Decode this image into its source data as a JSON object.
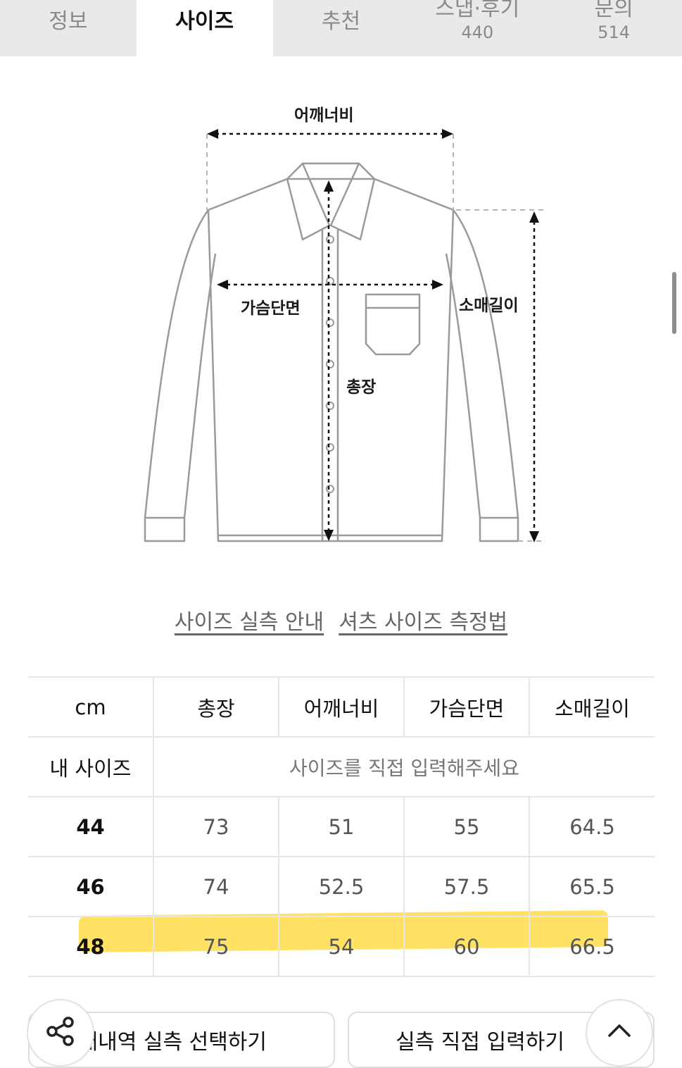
{
  "tabs": [
    {
      "label": "정보",
      "count": ""
    },
    {
      "label": "사이즈",
      "count": ""
    },
    {
      "label": "추천",
      "count": ""
    },
    {
      "label": "스냅·후기",
      "count": "440"
    },
    {
      "label": "문의",
      "count": "514"
    }
  ],
  "diagram": {
    "labels": {
      "shoulder": "어깨너비",
      "chest": "가슴단면",
      "length": "총장",
      "sleeve": "소매길이"
    }
  },
  "guide_links": {
    "measure_guide": "사이즈 실측 안내",
    "shirt_method": "셔츠 사이즈 측정법"
  },
  "size_table": {
    "unit": "cm",
    "columns": [
      "총장",
      "어깨너비",
      "가슴단면",
      "소매길이"
    ],
    "my_size": {
      "label": "내 사이즈",
      "prompt": "사이즈를 직접 입력해주세요"
    },
    "rows": [
      {
        "size": "44",
        "values": [
          "73",
          "51",
          "55",
          "64.5"
        ]
      },
      {
        "size": "46",
        "values": [
          "74",
          "52.5",
          "57.5",
          "65.5"
        ]
      },
      {
        "size": "48",
        "values": [
          "75",
          "54",
          "60",
          "66.5"
        ],
        "highlighted": true
      }
    ],
    "highlight_color": "#ffd728"
  },
  "bottom": {
    "select_purchase": "·매내역 실측 선택하기",
    "direct_input": "실측 직접 입력하기",
    "share_icon": "share-icon",
    "up_icon": "chevron-up-icon"
  }
}
